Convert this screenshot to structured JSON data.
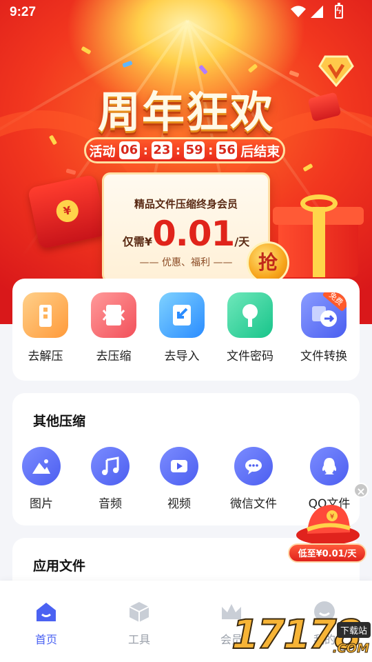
{
  "status_bar": {
    "time": "9:27",
    "icons": [
      "wifi-icon",
      "cell-signal-icon",
      "battery-charging-icon"
    ]
  },
  "banner": {
    "title": "周年狂欢",
    "countdown": {
      "prefix": "活动",
      "hours": "06",
      "minutes": "23",
      "seconds": "59",
      "centis": "56",
      "suffix": "后结束"
    },
    "promo": {
      "headline": "精品文件压缩终身会员",
      "price_prefix": "仅需¥",
      "price": "0.01",
      "price_unit": "/天",
      "footer": "—— 优惠、福利 ——"
    },
    "grab_label": "抢",
    "coin_symbol": "¥",
    "colors": {
      "primary": "#e8291a",
      "gold": "#ffd34a",
      "cream": "#fff9e6"
    }
  },
  "quick_actions": [
    {
      "label": "去解压",
      "icon": "unzip-icon",
      "color": "#ffb35a"
    },
    {
      "label": "去压缩",
      "icon": "compress-icon",
      "color": "#ff6b6b"
    },
    {
      "label": "去导入",
      "icon": "import-icon",
      "color": "#3aa6ff"
    },
    {
      "label": "文件密码",
      "icon": "file-lock-icon",
      "color": "#2fd39a"
    },
    {
      "label": "文件转换",
      "icon": "convert-icon",
      "color": "#5b74f5",
      "tag": "免费"
    }
  ],
  "other_compress": {
    "title": "其他压缩",
    "items": [
      {
        "label": "图片",
        "icon": "image-icon"
      },
      {
        "label": "音频",
        "icon": "music-icon"
      },
      {
        "label": "视频",
        "icon": "video-icon"
      },
      {
        "label": "微信文件",
        "icon": "wechat-icon"
      },
      {
        "label": "QQ文件",
        "icon": "qq-icon"
      }
    ]
  },
  "app_files": {
    "title": "应用文件"
  },
  "float_promo": {
    "label": "低至¥0.01/天",
    "close": "×",
    "coin_symbol": "¥"
  },
  "tabbar": {
    "tabs": [
      {
        "label": "首页",
        "icon": "home-icon",
        "active": true
      },
      {
        "label": "工具",
        "icon": "box-icon",
        "active": false
      },
      {
        "label": "会员",
        "icon": "crown-icon",
        "active": false
      },
      {
        "label": "我的",
        "icon": "profile-icon",
        "active": false
      }
    ],
    "active_color": "#4b62f2",
    "inactive_color": "#9aa0aa"
  },
  "watermark": {
    "text": "17178",
    "tag": "下载站",
    "suffix": ".COM"
  }
}
